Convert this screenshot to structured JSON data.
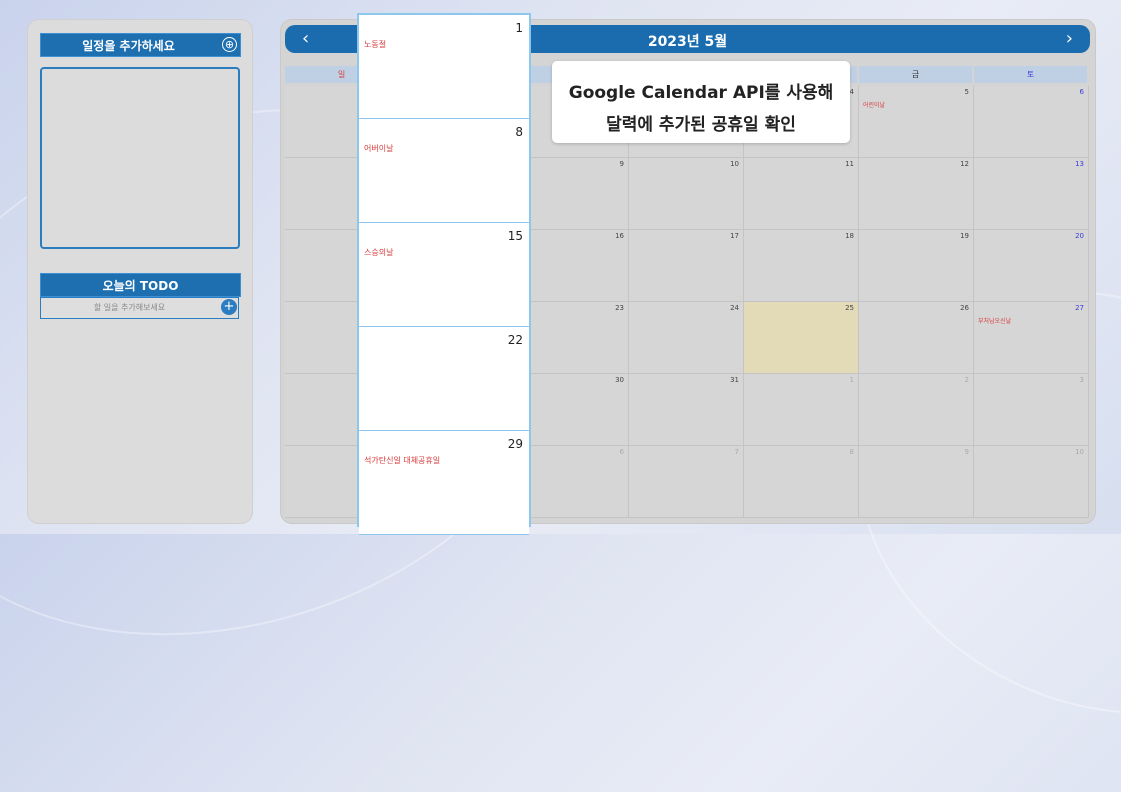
{
  "sidebar": {
    "add_title": "일정을 추가하세요",
    "add_plus": "⊕",
    "todo_title": "오늘의 TODO",
    "todo_placeholder": "할 일을 추가해보세요",
    "todo_plus": "+"
  },
  "calendar": {
    "title": "2023년 5월",
    "prev": "‹",
    "next": "›",
    "weekdays": [
      "일",
      "",
      "",
      "",
      "",
      "금",
      "토"
    ],
    "rows": [
      [
        {
          "n": ""
        },
        {
          "n": ""
        },
        {
          "n": ""
        },
        {
          "n": ""
        },
        {
          "n": "4"
        },
        {
          "n": "5",
          "hol": "어린이날"
        },
        {
          "n": "6"
        }
      ],
      [
        {
          "n": ""
        },
        {
          "n": ""
        },
        {
          "n": "9"
        },
        {
          "n": "10"
        },
        {
          "n": "11"
        },
        {
          "n": "12"
        },
        {
          "n": "13"
        }
      ],
      [
        {
          "n": ""
        },
        {
          "n": ""
        },
        {
          "n": "16"
        },
        {
          "n": "17"
        },
        {
          "n": "18"
        },
        {
          "n": "19"
        },
        {
          "n": "20"
        }
      ],
      [
        {
          "n": ""
        },
        {
          "n": ""
        },
        {
          "n": "23"
        },
        {
          "n": "24"
        },
        {
          "n": "25",
          "today": true
        },
        {
          "n": "26"
        },
        {
          "n": "27",
          "hol": "부처님오신날"
        }
      ],
      [
        {
          "n": ""
        },
        {
          "n": ""
        },
        {
          "n": "30"
        },
        {
          "n": "31"
        },
        {
          "n": "1",
          "other": true
        },
        {
          "n": "2",
          "other": true
        },
        {
          "n": "3",
          "other": true
        }
      ],
      [
        {
          "n": ""
        },
        {
          "n": ""
        },
        {
          "n": "6",
          "other": true
        },
        {
          "n": "7",
          "other": true
        },
        {
          "n": "8",
          "other": true
        },
        {
          "n": "9",
          "other": true
        },
        {
          "n": "10",
          "other": true
        }
      ]
    ]
  },
  "zoom_column": [
    {
      "n": "1",
      "hol": "노동절"
    },
    {
      "n": "8",
      "hol": "어버이날"
    },
    {
      "n": "15",
      "hol": "스승의날"
    },
    {
      "n": "22",
      "hol": ""
    },
    {
      "n": "29",
      "hol": "석가탄신일 대체공휴일"
    }
  ],
  "callout": {
    "line1": "Google Calendar API를 사용해",
    "line2": "달력에 추가된 공휴일 확인"
  }
}
